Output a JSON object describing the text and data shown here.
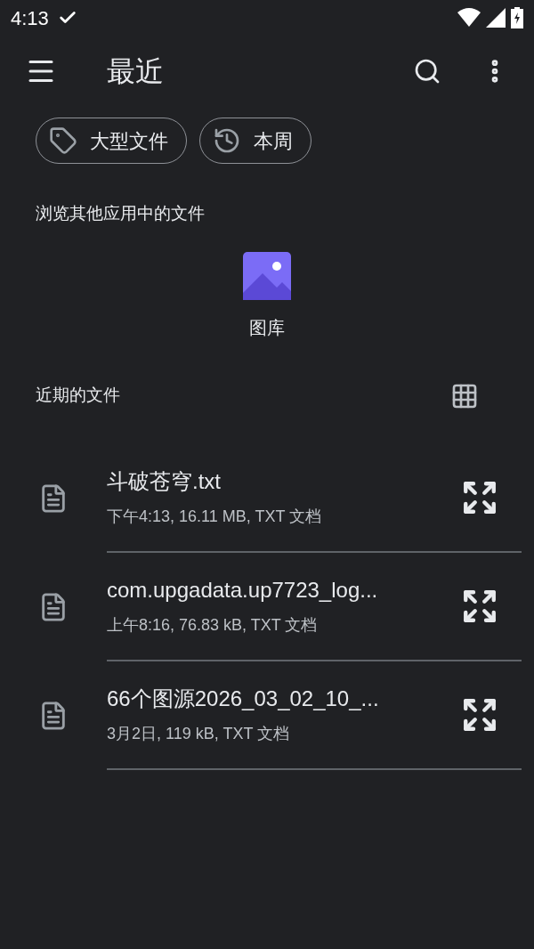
{
  "status_bar": {
    "time": "4:13"
  },
  "app_bar": {
    "title": "最近"
  },
  "chips": [
    {
      "label": "大型文件",
      "kind": "tag"
    },
    {
      "label": "本周",
      "kind": "history"
    }
  ],
  "apps_section": {
    "title": "浏览其他应用中的文件",
    "apps": [
      {
        "label": "图库"
      }
    ]
  },
  "recent_section": {
    "title": "近期的文件"
  },
  "files": [
    {
      "name": "斗破苍穹.txt",
      "details": "下午4:13, 16.11 MB, TXT 文档"
    },
    {
      "name": "com.upgadata.up7723_log...",
      "details": "上午8:16, 76.83 kB, TXT 文档"
    },
    {
      "name": "66个图源2026_03_02_10_...",
      "details": "3月2日, 119 kB, TXT 文档"
    }
  ]
}
